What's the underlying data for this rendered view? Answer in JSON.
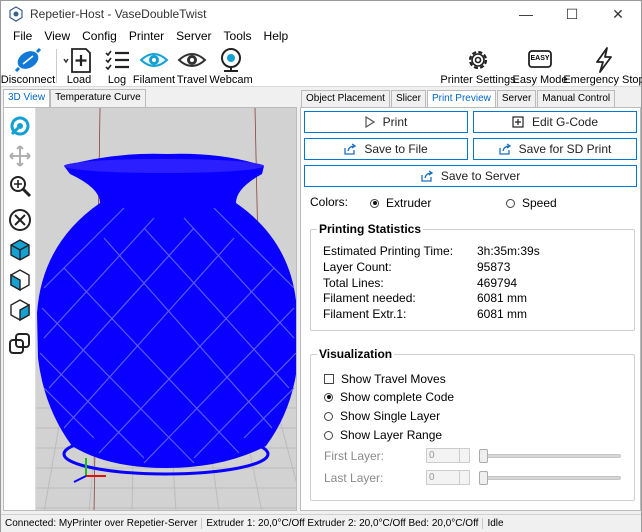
{
  "window": {
    "title": "Repetier-Host - VaseDoubleTwist",
    "minimize": "—",
    "maximize": "☐",
    "close": "✕"
  },
  "menu": [
    "File",
    "View",
    "Config",
    "Printer",
    "Server",
    "Tools",
    "Help"
  ],
  "toolbar": {
    "disconnect": "Disconnect",
    "load": "Load",
    "log": "Log",
    "filament": "Filament",
    "travel": "Travel",
    "webcam": "Webcam",
    "printer_settings": "Printer Settings",
    "easy_mode": "Easy Mode",
    "easy_badge": "EASY",
    "emergency_stop": "Emergency Stop"
  },
  "left_tabs": [
    "3D View",
    "Temperature Curve"
  ],
  "right_tabs": [
    "Object Placement",
    "Slicer",
    "Print Preview",
    "Server",
    "Manual Control"
  ],
  "buttons": {
    "print": "Print",
    "edit_gcode": "Edit G-Code",
    "save_to_file": "Save to File",
    "save_sd": "Save for SD Print",
    "save_server": "Save to Server"
  },
  "colors": {
    "label": "Colors:",
    "extruder": "Extruder",
    "speed": "Speed",
    "selected": "extruder"
  },
  "stats": {
    "title": "Printing Statistics",
    "rows": [
      {
        "label": "Estimated Printing Time:",
        "value": "3h:35m:39s"
      },
      {
        "label": "Layer Count:",
        "value": "95873"
      },
      {
        "label": "Total Lines:",
        "value": "469794"
      },
      {
        "label": "Filament needed:",
        "value": "6081 mm"
      },
      {
        "label": "Filament Extr.1:",
        "value": "6081 mm"
      }
    ]
  },
  "visualization": {
    "title": "Visualization",
    "show_travel": "Show Travel Moves",
    "complete": "Show complete Code",
    "single": "Show Single Layer",
    "range": "Show Layer Range",
    "first_layer": "First Layer:",
    "last_layer": "Last Layer:",
    "first_value": "0",
    "last_value": "0"
  },
  "status": {
    "connection": "Connected: MyPrinter over Repetier-Server",
    "temps": "Extruder 1: 20,0°C/Off Extruder 2: 20,0°C/Off Bed: 20,0°C/Off",
    "state": "Idle"
  },
  "colors_theme": {
    "accent": "#0078d7",
    "vase": "#0a00ff",
    "disconnect": "#1279d6"
  }
}
